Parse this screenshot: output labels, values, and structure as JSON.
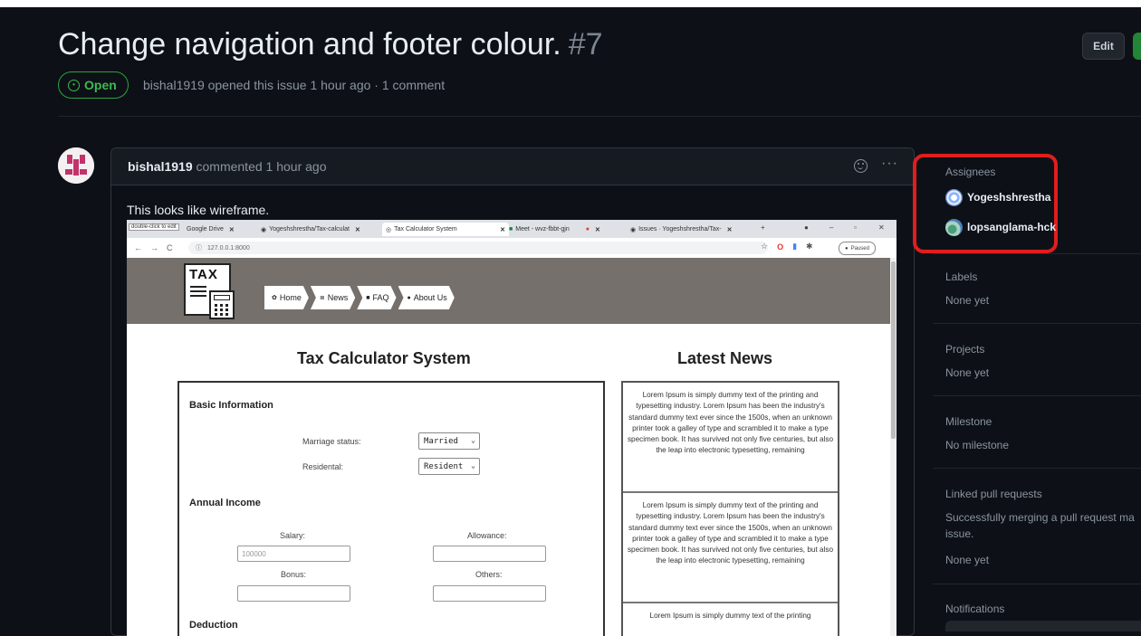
{
  "issue": {
    "title": "Change navigation and footer colour.",
    "number": "#7",
    "state": "Open",
    "meta": "bishal1919 opened this issue 1 hour ago · 1 comment",
    "edit_label": "Edit"
  },
  "comment": {
    "author": "bishal1919",
    "time": "commented 1 hour ago",
    "body": "This looks like wireframe.",
    "more": "···"
  },
  "screenshot": {
    "dblclick_hint": "double-click to edit",
    "tabs": [
      {
        "label": "Google Drive",
        "close": "✕"
      },
      {
        "label": "Yogeshshrestha/Tax-calculat",
        "close": "✕"
      },
      {
        "label": "Tax Calculator System",
        "close": "✕"
      },
      {
        "label": "Meet - wvz-fbbt-gjn",
        "close": "✕"
      },
      {
        "label": "Issues · Yogeshshrestha/Tax-",
        "close": "✕"
      }
    ],
    "new_tab": "+",
    "url": "127.0.0.1:8000",
    "paused": "Paused",
    "nav_items": [
      "Home",
      "News",
      "FAQ",
      "About Us"
    ],
    "logo_text": "TAX",
    "calc_title": "Tax Calculator System",
    "news_title": "Latest News",
    "basic_info": "Basic Information",
    "marriage_label": "Marriage status:",
    "marriage_value": "Married",
    "residential_label": "Residental:",
    "residential_value": "Resident",
    "annual_income": "Annual Income",
    "salary_label": "Salary:",
    "salary_placeholder": "100000",
    "allowance_label": "Allowance:",
    "bonus_label": "Bonus:",
    "others_label": "Others:",
    "deduction": "Deduction",
    "news_text": "Lorem Ipsum is simply dummy text of the printing and typesetting industry. Lorem Ipsum has been the industry's standard dummy text ever since the 1500s, when an unknown printer took a galley of type and scrambled it to make a type specimen book. It has survived not only five centuries, but also the leap into electronic typesetting, remaining",
    "news_text_short": "Lorem Ipsum is simply dummy text of the printing"
  },
  "sidebar": {
    "assignees_label": "Assignees",
    "assignees": [
      "Yogeshshrestha",
      "lopsanglama-hck"
    ],
    "labels_label": "Labels",
    "labels_value": "None yet",
    "projects_label": "Projects",
    "projects_value": "None yet",
    "milestone_label": "Milestone",
    "milestone_value": "No milestone",
    "linked_label": "Linked pull requests",
    "linked_desc_1": "Successfully merging a pull request ma",
    "linked_desc_2": "issue.",
    "linked_value": "None yet",
    "notifications_label": "Notifications"
  },
  "colors": {
    "background": "#0d1117",
    "open_green": "#3fb950",
    "annotation_red": "#e11d1d"
  }
}
